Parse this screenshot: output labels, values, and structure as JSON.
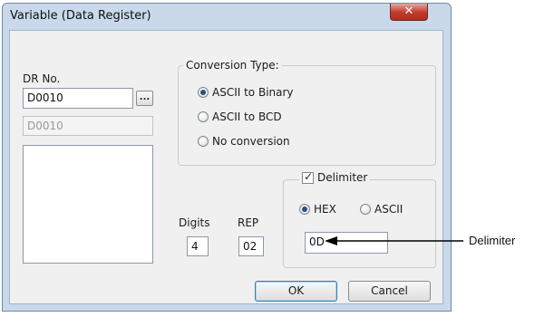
{
  "window": {
    "title": "Variable (Data Register)",
    "close_glyph": "✕"
  },
  "dr": {
    "label": "DR No.",
    "value": "D0010",
    "browse_label": "...",
    "display_value": "D0010"
  },
  "conversion": {
    "title": "Conversion Type:",
    "options": [
      "ASCII to Binary",
      "ASCII to BCD",
      "No conversion"
    ],
    "selected": "ASCII to Binary"
  },
  "digits": {
    "label": "Digits",
    "value": "4"
  },
  "rep": {
    "label": "REP",
    "value": "02"
  },
  "delimiter": {
    "checkbox_label": "Delimiter",
    "checked": true,
    "modes": [
      "HEX",
      "ASCII"
    ],
    "selected_mode": "HEX",
    "value": "0D"
  },
  "buttons": {
    "ok": "OK",
    "cancel": "Cancel"
  },
  "annotation": {
    "label": "Delimiter"
  }
}
